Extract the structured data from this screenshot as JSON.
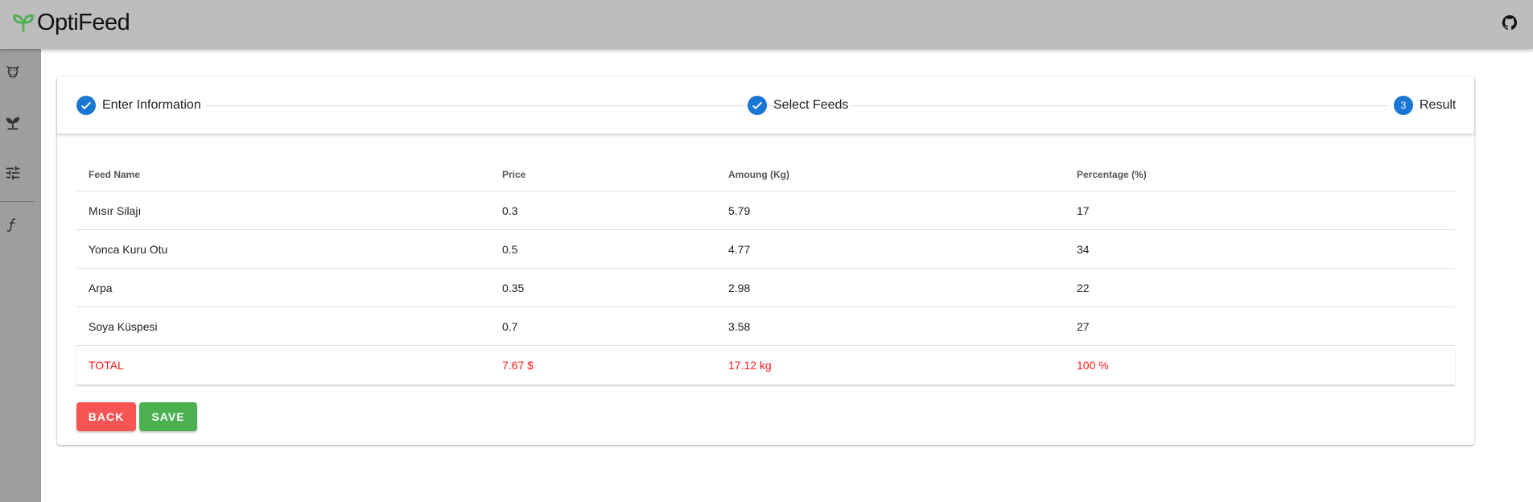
{
  "app": {
    "title": "OptiFeed",
    "brand_color": "#4caf50"
  },
  "header": {
    "github_icon": "github-icon"
  },
  "sidebar": {
    "items": [
      {
        "icon": "cow-icon"
      },
      {
        "icon": "sprout-icon"
      },
      {
        "icon": "tune-icon"
      },
      {
        "icon": "function-icon"
      }
    ]
  },
  "stepper": {
    "steps": [
      {
        "label": "Enter Information",
        "state": "done"
      },
      {
        "label": "Select Feeds",
        "state": "done"
      },
      {
        "label": "Result",
        "number": "3",
        "state": "active"
      }
    ]
  },
  "table": {
    "headers": [
      "Feed Name",
      "Price",
      "Amoung (Kg)",
      "Percentage (%)"
    ],
    "rows": [
      [
        "Mısır Silajı",
        "0.3",
        "5.79",
        "17"
      ],
      [
        "Yonca Kuru Otu",
        "0.5",
        "4.77",
        "34"
      ],
      [
        "Arpa",
        "0.35",
        "2.98",
        "22"
      ],
      [
        "Soya Küspesi",
        "0.7",
        "3.58",
        "27"
      ]
    ],
    "total": [
      "TOTAL",
      "7.67 $",
      "17.12 kg",
      "100 %"
    ]
  },
  "actions": {
    "back_label": "BACK",
    "save_label": "SAVE"
  }
}
